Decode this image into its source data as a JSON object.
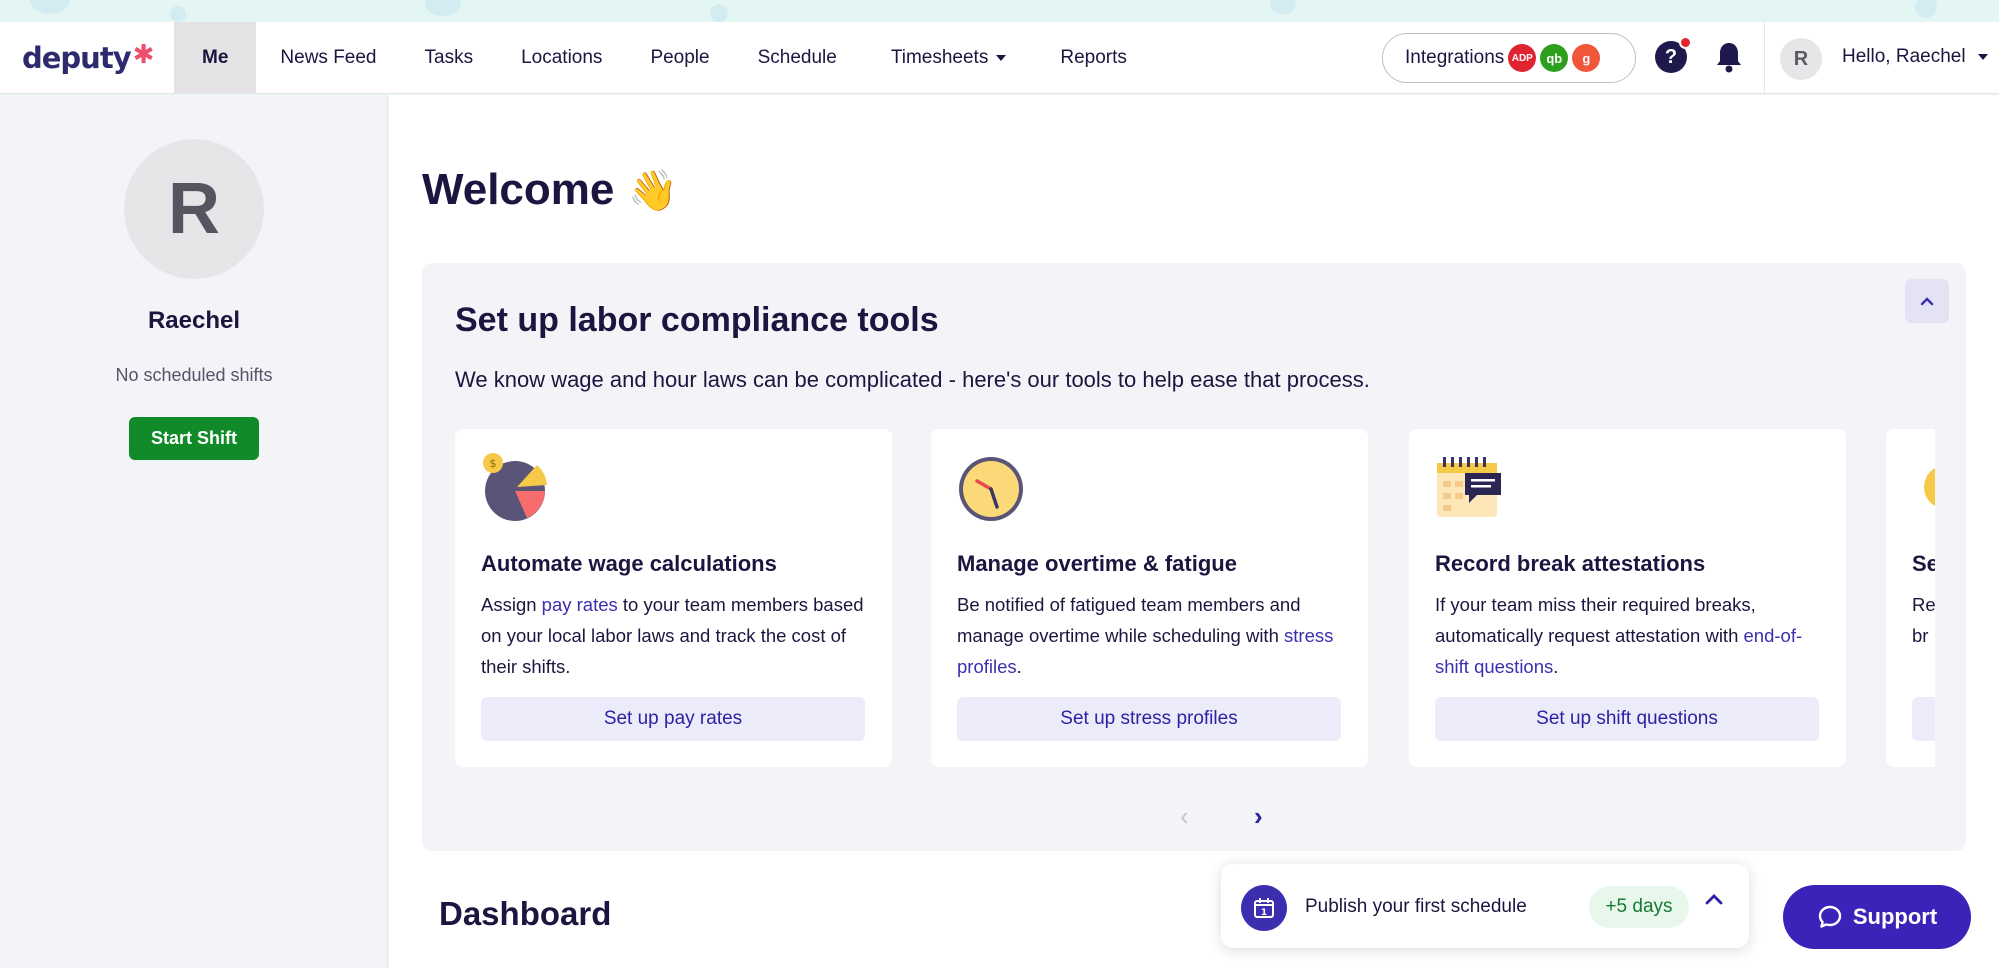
{
  "header": {
    "logo": "deputy",
    "nav": [
      {
        "label": "Me",
        "active": true
      },
      {
        "label": "News Feed"
      },
      {
        "label": "Tasks"
      },
      {
        "label": "Locations"
      },
      {
        "label": "People"
      },
      {
        "label": "Schedule"
      },
      {
        "label": "Timesheets",
        "dropdown": true
      },
      {
        "label": "Reports"
      }
    ],
    "integrations_label": "Integrations",
    "integration_badges": [
      {
        "text": "ADP",
        "color": "#e0242f"
      },
      {
        "text": "qb",
        "color": "#2ca01c"
      },
      {
        "text": "g",
        "color": "#f0563a"
      }
    ],
    "user_initial": "R",
    "greeting": "Hello, Raechel"
  },
  "sidebar": {
    "initial": "R",
    "name": "Raechel",
    "status": "No scheduled shifts",
    "start_shift_label": "Start Shift"
  },
  "main": {
    "welcome": "Welcome",
    "wave_emoji": "👋",
    "panel": {
      "title": "Set up labor compliance tools",
      "subtitle": "We know wage and hour laws can be complicated - here's our tools to help ease that process.",
      "cards": [
        {
          "title": "Automate wage calculations",
          "text_before": "Assign ",
          "link": "pay rates",
          "text_after": " to your team members based on your local labor laws and track the cost of their shifts.",
          "button": "Set up pay rates",
          "icon": "pie-chart-icon"
        },
        {
          "title": "Manage overtime & fatigue",
          "text_before": "Be notified of fatigued team members and manage overtime while scheduling with ",
          "link": "stress profiles",
          "text_after": ".",
          "button": "Set up stress profiles",
          "icon": "clock-icon"
        },
        {
          "title": "Record break attestations",
          "text_before": "If your team miss their required breaks, automatically request attestation with ",
          "link": "end-of-shift questions",
          "text_after": ".",
          "button": "Set up shift questions",
          "icon": "calendar-message-icon"
        },
        {
          "title": "Se",
          "text_before": "Re br",
          "link": "",
          "text_after": "",
          "button": "",
          "icon": "lightbulb-icon"
        }
      ]
    },
    "dashboard_title": "Dashboard"
  },
  "publish": {
    "text": "Publish your first schedule",
    "badge": "+5 days",
    "calendar_day": "1"
  },
  "support": {
    "label": "Support"
  },
  "colors": {
    "primary": "#3b2fb0",
    "success": "#118a2a",
    "text": "#1b1640",
    "notification": "#e0242f"
  }
}
